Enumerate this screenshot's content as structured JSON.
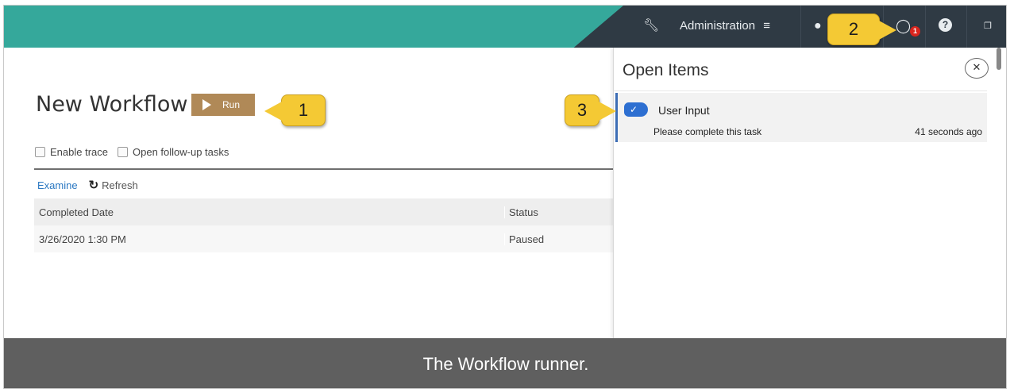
{
  "topbar": {
    "admin_label": "Administration",
    "notification_count": "1",
    "brand_color": "#35a89b",
    "bar_color": "#2f3a44",
    "icons": [
      "wrench-icon",
      "menu-icon",
      "user-icon",
      "chat-icon",
      "help-icon",
      "expand-icon"
    ]
  },
  "callouts": {
    "one": "1",
    "two": "2",
    "three": "3"
  },
  "workflow": {
    "title": "New Workflow",
    "run_label": "Run",
    "enable_trace_label": "Enable trace",
    "follow_up_label": "Open follow-up tasks",
    "examine_label": "Examine",
    "refresh_label": "Refresh",
    "table": {
      "headers": [
        "Completed Date",
        "Status"
      ],
      "rows": [
        [
          "3/26/2020 1:30 PM",
          "Paused"
        ]
      ]
    }
  },
  "panel": {
    "title": "Open Items",
    "item": {
      "title": "User Input",
      "description": "Please complete this task",
      "time": "41 seconds ago"
    }
  },
  "caption": "The Workflow runner."
}
